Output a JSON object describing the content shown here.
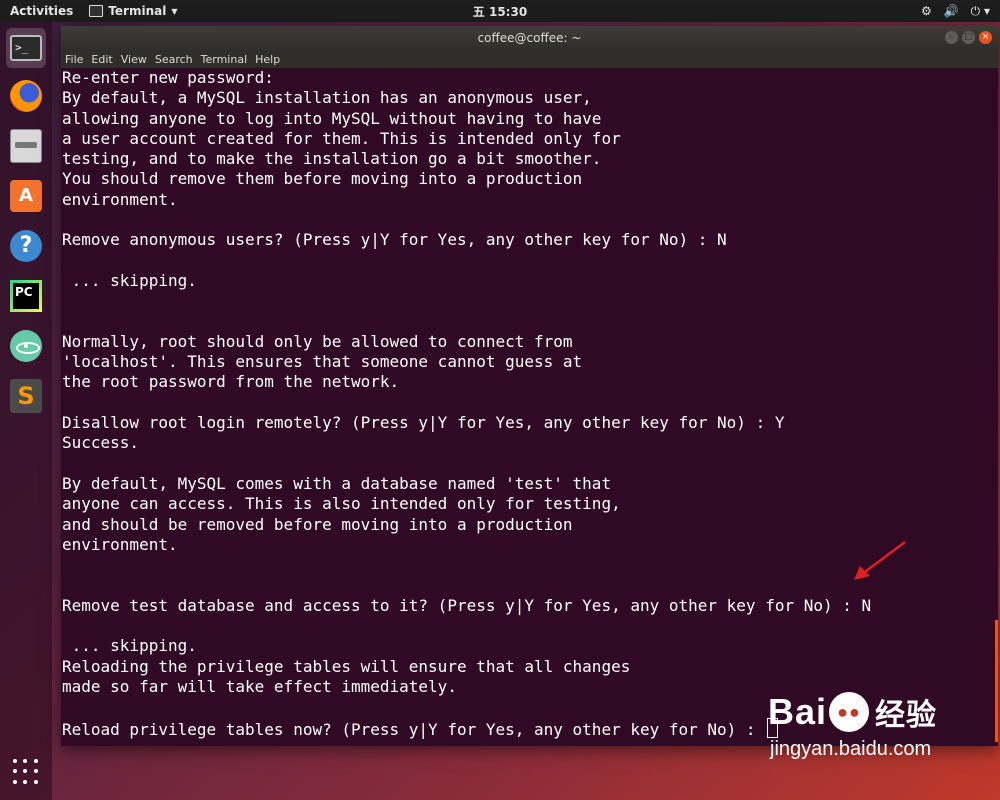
{
  "topbar": {
    "activities": "Activities",
    "app_name": "Terminal",
    "clock": "五 15:30"
  },
  "dock": {
    "items": [
      "terminal",
      "firefox",
      "files",
      "ubuntu-software",
      "help",
      "pycharm",
      "atom",
      "sublime-text",
      "show-applications"
    ]
  },
  "window": {
    "title": "coffee@coffee: ~",
    "menu": [
      "File",
      "Edit",
      "View",
      "Search",
      "Terminal",
      "Help"
    ]
  },
  "terminal": {
    "lines": [
      "Re-enter new password:",
      "By default, a MySQL installation has an anonymous user,",
      "allowing anyone to log into MySQL without having to have",
      "a user account created for them. This is intended only for",
      "testing, and to make the installation go a bit smoother.",
      "You should remove them before moving into a production",
      "environment.",
      "",
      "Remove anonymous users? (Press y|Y for Yes, any other key for No) : N",
      "",
      " ... skipping.",
      "",
      "",
      "Normally, root should only be allowed to connect from",
      "'localhost'. This ensures that someone cannot guess at",
      "the root password from the network.",
      "",
      "Disallow root login remotely? (Press y|Y for Yes, any other key for No) : Y",
      "Success.",
      "",
      "By default, MySQL comes with a database named 'test' that",
      "anyone can access. This is also intended only for testing,",
      "and should be removed before moving into a production",
      "environment.",
      "",
      "",
      "Remove test database and access to it? (Press y|Y for Yes, any other key for No) : N",
      "",
      " ... skipping.",
      "Reloading the privilege tables will ensure that all changes",
      "made so far will take effect immediately.",
      "",
      "Reload privilege tables now? (Press y|Y for Yes, any other key for No) : "
    ]
  },
  "watermark": {
    "logo_left": "Bai",
    "logo_right": "经验",
    "url": "jingyan.baidu.com"
  },
  "colors": {
    "terminal_bg": "#300a24",
    "accent": "#e95420",
    "arrow": "#e02020"
  }
}
